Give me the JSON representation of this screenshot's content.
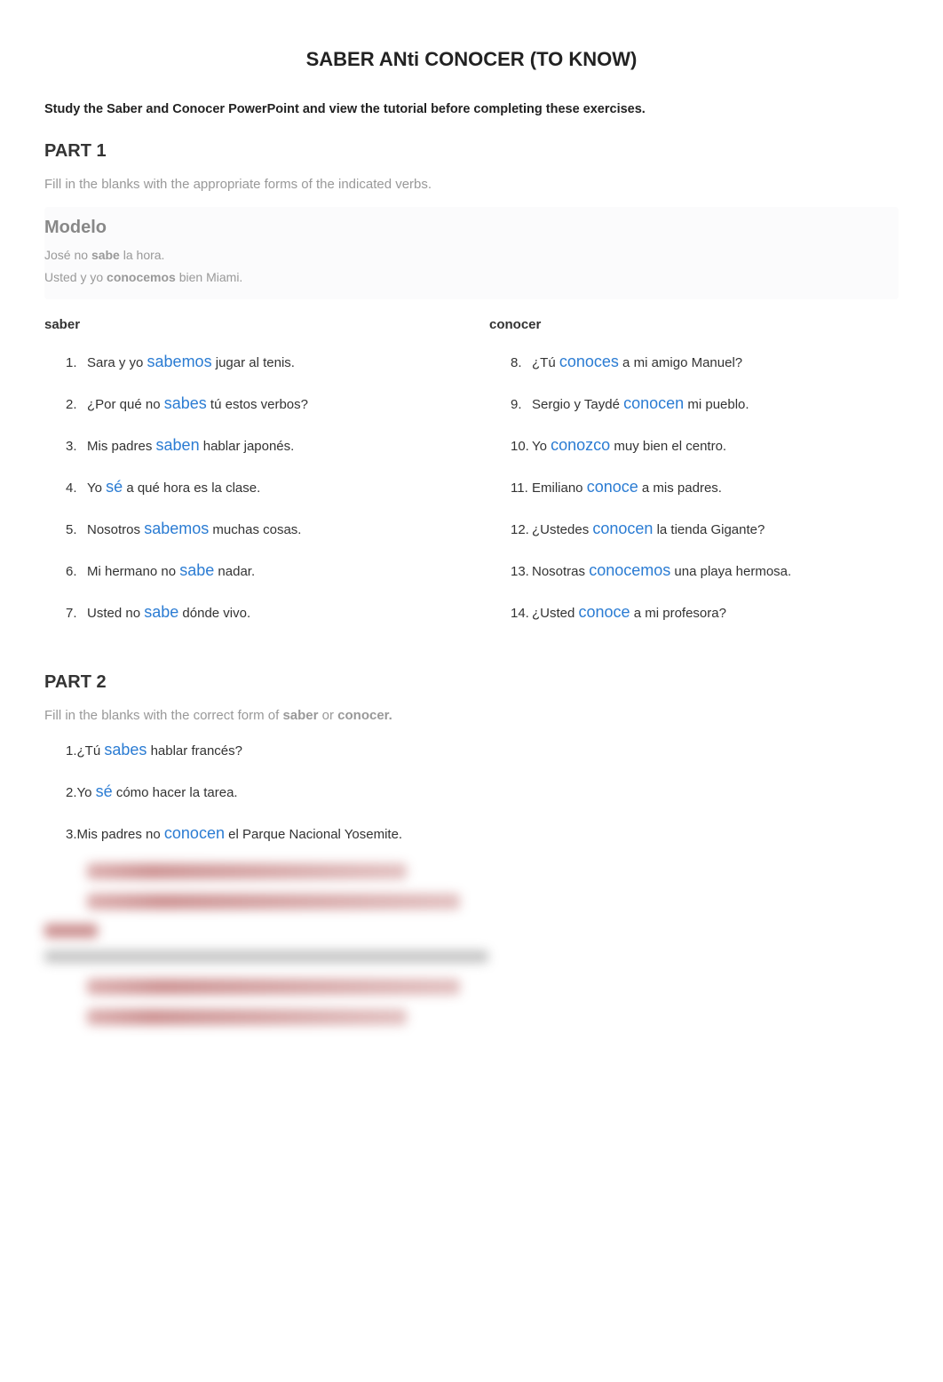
{
  "title": "SABER ANti CONOCER (TO KNOW)",
  "instruction": "Study the Saber and Conocer PowerPoint and view the tutorial before completing these exercises.",
  "part1": {
    "heading": "PART 1",
    "sub": "Fill in the blanks with the appropriate forms of the indicated verbs."
  },
  "modelo": {
    "heading": "Modelo",
    "line1_a": "José no ",
    "line1_b": "sabe",
    "line1_c": " la hora.",
    "line2_a": "Usted y yo ",
    "line2_b": "conocemos",
    "line2_c": " bien Miami."
  },
  "saber": {
    "heading": "saber",
    "items": [
      {
        "n": "1.",
        "pre": "Sara y yo ",
        "ans": "sabemos",
        "post": " jugar al tenis."
      },
      {
        "n": "2.",
        "pre": "¿Por qué no ",
        "ans": "sabes",
        "post": " tú estos verbos?"
      },
      {
        "n": "3.",
        "pre": "Mis padres ",
        "ans": "saben",
        "post": " hablar japonés."
      },
      {
        "n": "4.",
        "pre": "Yo ",
        "ans": "sé",
        "post": " a qué hora es la clase."
      },
      {
        "n": "5.",
        "pre": "Nosotros ",
        "ans": "sabemos",
        "post": " muchas cosas."
      },
      {
        "n": "6.",
        "pre": "Mi hermano no ",
        "ans": "sabe",
        "post": " nadar."
      },
      {
        "n": "7.",
        "pre": "Usted no ",
        "ans": "sabe",
        "post": " dónde vivo."
      }
    ]
  },
  "conocer": {
    "heading": "conocer",
    "items": [
      {
        "n": "8.",
        "pre": "¿Tú ",
        "ans": "conoces",
        "post": " a mi amigo Manuel?"
      },
      {
        "n": "9.",
        "pre": "Sergio y Taydé ",
        "ans": "conocen",
        "post": " mi pueblo."
      },
      {
        "n": "10.",
        "pre": "Yo ",
        "ans": "conozco",
        "post": " muy bien el centro."
      },
      {
        "n": "11.",
        "pre": "Emiliano ",
        "ans": "conoce",
        "post": " a mis padres."
      },
      {
        "n": "12.",
        "pre": "¿Ustedes ",
        "ans": "conocen",
        "post": " la tienda Gigante?"
      },
      {
        "n": "13.",
        "pre": "Nosotras ",
        "ans": "conocemos",
        "post": " una playa hermosa."
      },
      {
        "n": "14.",
        "pre": "¿Usted ",
        "ans": "conoce",
        "post": " a mi profesora?"
      }
    ]
  },
  "part2": {
    "heading": "PART 2",
    "sub_a": "Fill in the blanks with the correct form of ",
    "sub_b": "saber",
    "sub_c": " or ",
    "sub_d": "conocer.",
    "items": [
      {
        "n": "1.",
        "pre": "¿Tú ",
        "ans": "sabes",
        "post": " hablar francés?"
      },
      {
        "n": "2.",
        "pre": "Yo ",
        "ans": "sé",
        "post": " cómo hacer la tarea."
      },
      {
        "n": "3.",
        "pre": "Mis padres no ",
        "ans": "conocen",
        "post": " el Parque Nacional Yosemite."
      }
    ]
  }
}
